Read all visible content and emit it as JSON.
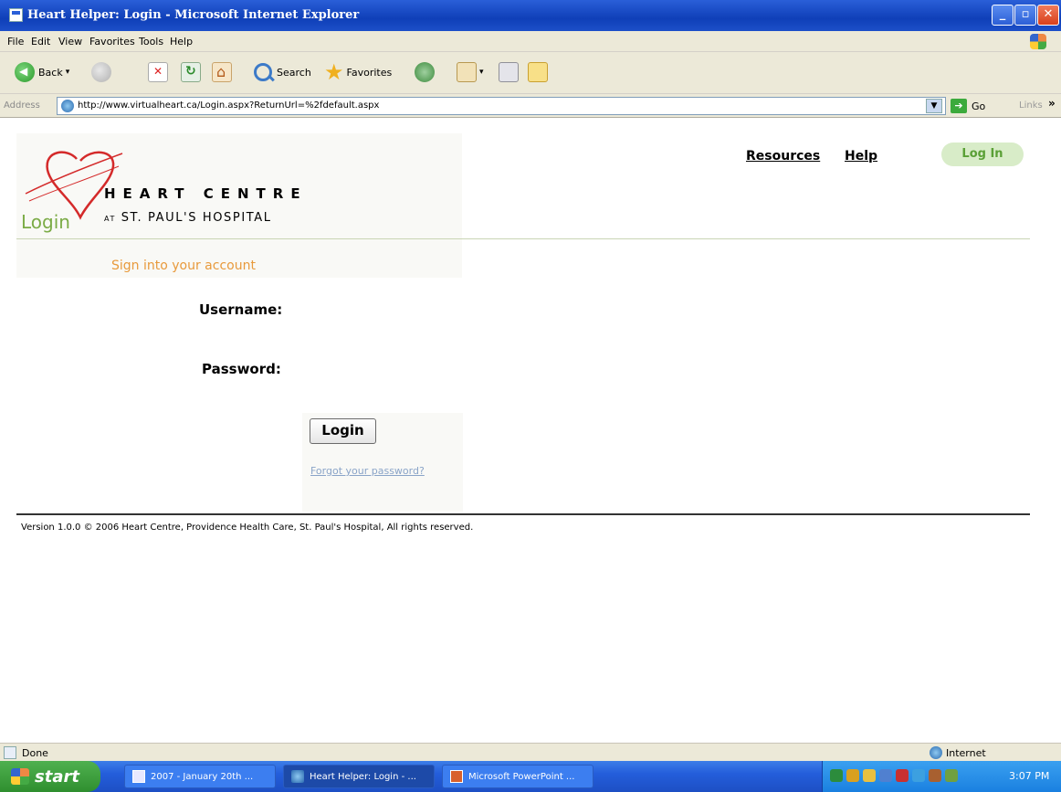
{
  "window": {
    "title": "Heart Helper: Login - Microsoft Internet Explorer",
    "controls": {
      "minimize": "_",
      "maximize": "▫",
      "close": "✕"
    }
  },
  "menu": [
    "File",
    "Edit",
    "View",
    "Favorites",
    "Tools",
    "Help"
  ],
  "toolbar": {
    "back_label": "Back",
    "search_label": "Search",
    "favorites_label": "Favorites"
  },
  "address": {
    "label": "Address",
    "url": "http://www.virtualheart.ca/Login.aspx?ReturnUrl=%2fdefault.aspx",
    "go_label": "Go",
    "links_label": "Links"
  },
  "site": {
    "logo_line1": "HEART CENTRE",
    "logo_at": "AT",
    "logo_line2": "ST. PAUL'S HOSPITAL",
    "nav": {
      "resources": "Resources",
      "help": "Help",
      "login": "Log In"
    },
    "page_title": "Login",
    "sign_in_heading": "Sign into your account",
    "username_label": "Username:",
    "password_label": "Password:",
    "login_button": "Login",
    "forgot_link": "Forgot your password?",
    "footer": "Version 1.0.0 © 2006 Heart Centre, Providence Health Care, St. Paul's Hospital, All rights reserved."
  },
  "status": {
    "left": "Done",
    "zone": "Internet"
  },
  "taskbar": {
    "start": "start",
    "tasks": [
      "2007 - January 20th ...",
      "Heart Helper: Login - ...",
      "Microsoft PowerPoint ..."
    ],
    "clock": "3:07 PM"
  },
  "colors": {
    "accent_green": "#7bab46",
    "heading_orange": "#e89a3c",
    "logo_red": "#d42a2a",
    "pill_bg": "#d8ecc8"
  }
}
